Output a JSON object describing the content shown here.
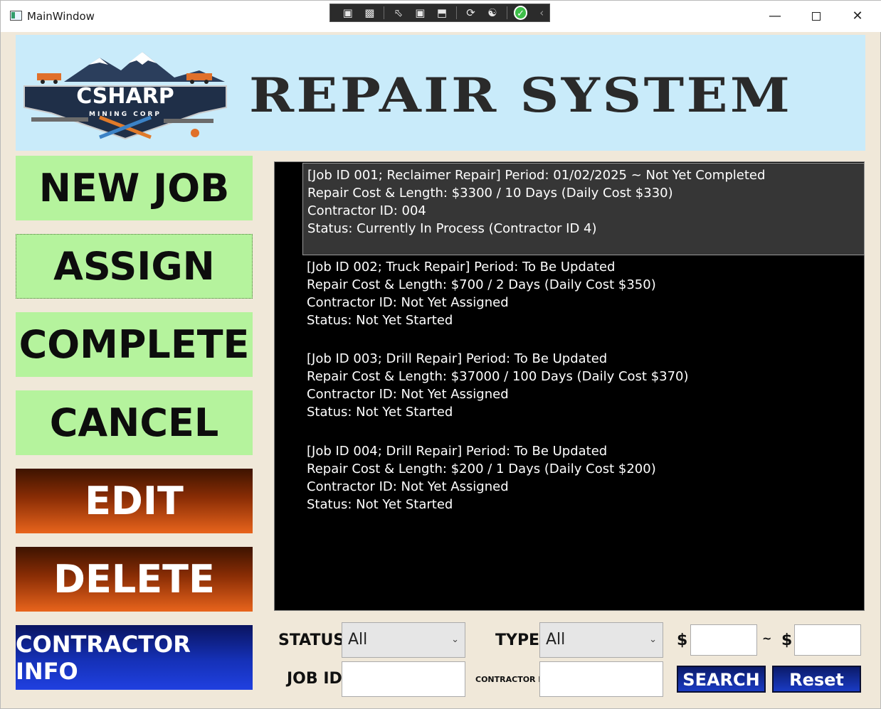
{
  "window": {
    "title": "MainWindow"
  },
  "banner": {
    "logo_main": "CSHARP",
    "logo_sub": "MINING CORP",
    "title": "REPAIR SYSTEM"
  },
  "actions": {
    "new_job": "NEW JOB",
    "assign": "ASSIGN",
    "complete": "COMPLETE",
    "cancel": "CANCEL",
    "edit": "EDIT",
    "delete": "DELETE",
    "contractor_info": "CONTRACTOR INFO"
  },
  "jobs": [
    {
      "line1": "[Job ID 001; Reclaimer Repair]  Period: 01/02/2025 ~ Not Yet Completed",
      "line2": "Repair Cost & Length: $3300 / 10 Days (Daily Cost $330)",
      "line3": "Contractor ID: 004",
      "line4": "Status: Currently In Process (Contractor ID 4)",
      "selected": true
    },
    {
      "line1": "[Job ID 002; Truck Repair]  Period: To Be Updated",
      "line2": "Repair Cost & Length: $700 / 2 Days (Daily Cost $350)",
      "line3": "Contractor ID: Not Yet Assigned",
      "line4": "Status: Not Yet Started",
      "selected": false
    },
    {
      "line1": "[Job ID 003; Drill Repair]  Period: To Be Updated",
      "line2": "Repair Cost & Length: $37000 / 100 Days (Daily Cost $370)",
      "line3": "Contractor ID: Not Yet Assigned",
      "line4": "Status: Not Yet Started",
      "selected": false
    },
    {
      "line1": "[Job ID 004; Drill Repair]  Period: To Be Updated",
      "line2": "Repair Cost & Length: $200 / 1 Days (Daily Cost $200)",
      "line3": "Contractor ID: Not Yet Assigned",
      "line4": "Status: Not Yet Started",
      "selected": false
    }
  ],
  "filters": {
    "status_label": "STATUS",
    "status_value": "All",
    "type_label": "TYPE",
    "type_value": "All",
    "dollar_min_label": "$",
    "range_sep": "~",
    "dollar_max_label": "$",
    "min_cost_value": "",
    "max_cost_value": "",
    "job_id_label": "JOB ID",
    "job_id_value": "",
    "contractor_id_label": "CONTRACTOR ID",
    "contractor_id_value": "",
    "search_label": "SEARCH",
    "reset_label": "Reset"
  },
  "colors": {
    "green_button": "#b5f39d",
    "orange_button": "#e8641c",
    "blue_button": "#1531b8",
    "banner_bg": "#c9ebfa",
    "list_bg": "#000000",
    "selected_row": "#363636"
  },
  "icons": {
    "app": "window-icon",
    "devbar": [
      "live-visual-tree-icon",
      "camera-icon",
      "select-element-icon",
      "display-layout-adorners-icon",
      "track-focus-icon",
      "hot-reload-icon",
      "accessibility-icon",
      "check-icon",
      "collapse-chevron-icon"
    ]
  }
}
